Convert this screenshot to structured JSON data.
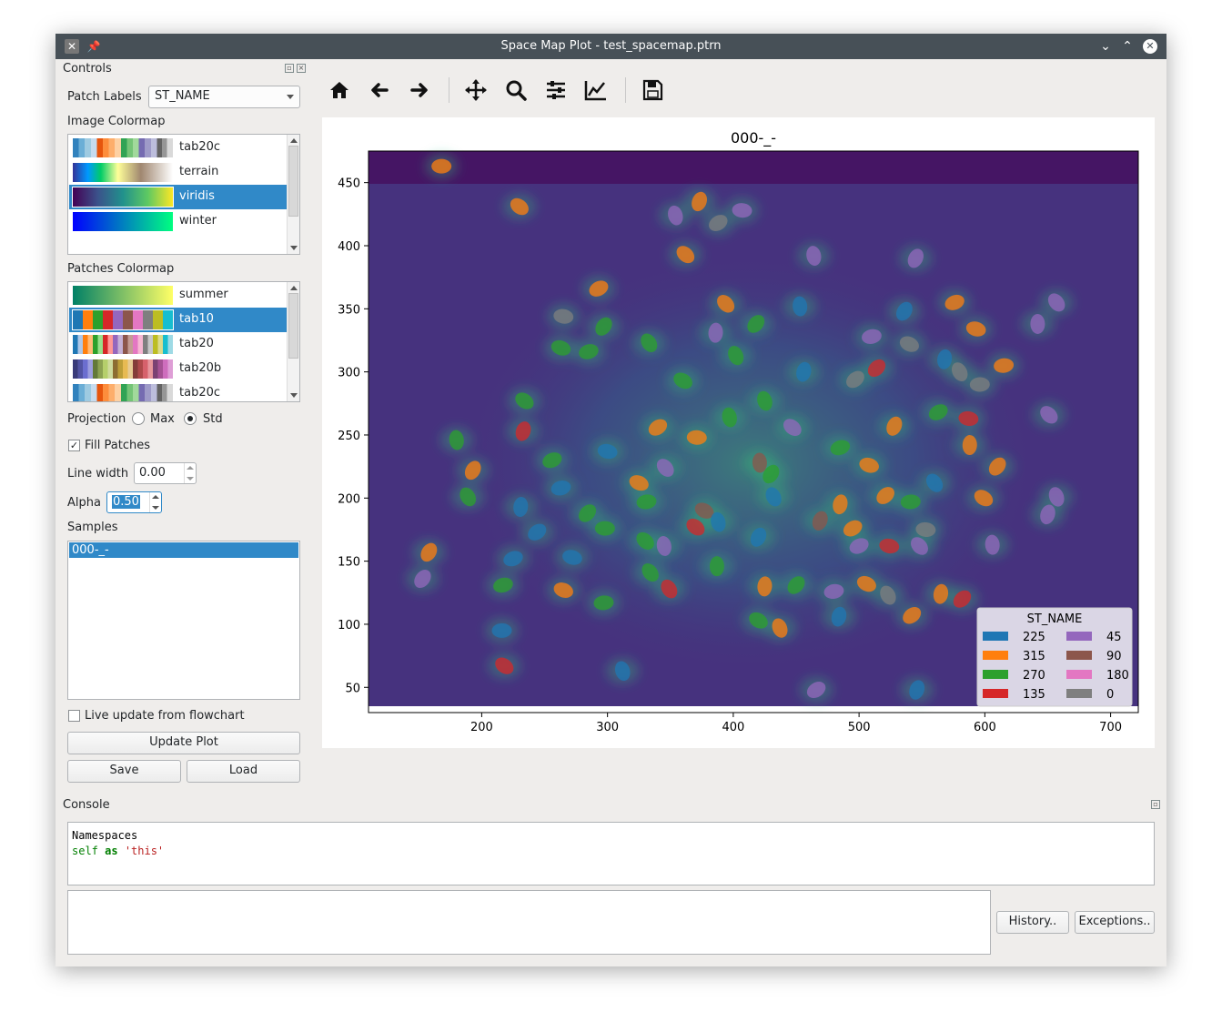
{
  "window": {
    "title": "Space Map Plot - test_spacemap.ptrn"
  },
  "controls": {
    "title": "Controls",
    "patch_labels": {
      "label": "Patch Labels",
      "value": "ST_NAME"
    },
    "image_colormap": {
      "label": "Image Colormap",
      "items": [
        "tab20c",
        "terrain",
        "viridis",
        "winter"
      ],
      "selected": "viridis"
    },
    "patches_colormap": {
      "label": "Patches Colormap",
      "items": [
        "summer",
        "tab10",
        "tab20",
        "tab20b",
        "tab20c"
      ],
      "selected": "tab10"
    },
    "projection": {
      "label": "Projection",
      "options": [
        "Max",
        "Std"
      ],
      "selected": "Std"
    },
    "fill_patches": {
      "label": "Fill Patches",
      "checked": true
    },
    "line_width": {
      "label": "Line width",
      "value": "0.00"
    },
    "alpha": {
      "label": "Alpha",
      "value": "0.50"
    },
    "samples": {
      "label": "Samples",
      "items": [
        "000-_-"
      ]
    },
    "live_update": {
      "label": "Live update from flowchart",
      "checked": false
    },
    "update_plot": "Update Plot",
    "save": "Save",
    "load": "Load"
  },
  "toolbar": {
    "icons": [
      "home-icon",
      "back-arrow-icon",
      "forward-arrow-icon",
      "pan-icon",
      "zoom-icon",
      "configure-subplots-icon",
      "edit-axis-icon",
      "save-icon"
    ]
  },
  "chart_data": {
    "type": "scatter",
    "title": "000-_-",
    "xlabel": "",
    "ylabel": "",
    "xlim": [
      110,
      722
    ],
    "ylim": [
      30,
      475
    ],
    "xticks": [
      200,
      300,
      400,
      500,
      600,
      700
    ],
    "yticks": [
      50,
      100,
      150,
      200,
      250,
      300,
      350,
      400,
      450
    ],
    "grid": false,
    "legend": {
      "title": "ST_NAME",
      "placement": "bottom-right",
      "entries": [
        {
          "label": "225",
          "color": "#1f77b4"
        },
        {
          "label": "315",
          "color": "#ff7f0e"
        },
        {
          "label": "270",
          "color": "#2ca02c"
        },
        {
          "label": "135",
          "color": "#d62728"
        },
        {
          "label": "45",
          "color": "#9467bd"
        },
        {
          "label": "90",
          "color": "#8c564b"
        },
        {
          "label": "180",
          "color": "#e377c2"
        },
        {
          "label": "0",
          "color": "#7f7f7f"
        }
      ]
    },
    "image_colormap": "viridis",
    "patch_alpha": 0.5,
    "patches": [
      {
        "x": 168,
        "y": 463,
        "label": "315"
      },
      {
        "x": 230,
        "y": 431,
        "label": "315"
      },
      {
        "x": 354,
        "y": 424,
        "label": "45"
      },
      {
        "x": 373,
        "y": 435,
        "label": "315"
      },
      {
        "x": 388,
        "y": 418,
        "label": "0"
      },
      {
        "x": 407,
        "y": 428,
        "label": "45"
      },
      {
        "x": 362,
        "y": 393,
        "label": "315"
      },
      {
        "x": 464,
        "y": 392,
        "label": "45"
      },
      {
        "x": 545,
        "y": 390,
        "label": "45"
      },
      {
        "x": 293,
        "y": 366,
        "label": "315"
      },
      {
        "x": 265,
        "y": 344,
        "label": "0"
      },
      {
        "x": 394,
        "y": 354,
        "label": "315"
      },
      {
        "x": 453,
        "y": 352,
        "label": "225"
      },
      {
        "x": 536,
        "y": 348,
        "label": "225"
      },
      {
        "x": 576,
        "y": 355,
        "label": "315"
      },
      {
        "x": 593,
        "y": 334,
        "label": "315"
      },
      {
        "x": 657,
        "y": 355,
        "label": "45"
      },
      {
        "x": 642,
        "y": 338,
        "label": "45"
      },
      {
        "x": 297,
        "y": 336,
        "label": "270"
      },
      {
        "x": 285,
        "y": 316,
        "label": "270"
      },
      {
        "x": 263,
        "y": 319,
        "label": "270"
      },
      {
        "x": 333,
        "y": 323,
        "label": "270"
      },
      {
        "x": 386,
        "y": 331,
        "label": "45"
      },
      {
        "x": 418,
        "y": 338,
        "label": "270"
      },
      {
        "x": 510,
        "y": 328,
        "label": "45"
      },
      {
        "x": 540,
        "y": 322,
        "label": "0"
      },
      {
        "x": 580,
        "y": 300,
        "label": "0"
      },
      {
        "x": 568,
        "y": 310,
        "label": "225"
      },
      {
        "x": 514,
        "y": 303,
        "label": "135"
      },
      {
        "x": 615,
        "y": 305,
        "label": "315"
      },
      {
        "x": 360,
        "y": 293,
        "label": "270"
      },
      {
        "x": 402,
        "y": 313,
        "label": "270"
      },
      {
        "x": 456,
        "y": 300,
        "label": "225"
      },
      {
        "x": 497,
        "y": 294,
        "label": "0"
      },
      {
        "x": 596,
        "y": 290,
        "label": "0"
      },
      {
        "x": 234,
        "y": 277,
        "label": "270"
      },
      {
        "x": 425,
        "y": 277,
        "label": "270"
      },
      {
        "x": 233,
        "y": 253,
        "label": "135"
      },
      {
        "x": 340,
        "y": 256,
        "label": "315"
      },
      {
        "x": 371,
        "y": 248,
        "label": "315"
      },
      {
        "x": 447,
        "y": 256,
        "label": "45"
      },
      {
        "x": 397,
        "y": 264,
        "label": "270"
      },
      {
        "x": 528,
        "y": 257,
        "label": "315"
      },
      {
        "x": 563,
        "y": 268,
        "label": "270"
      },
      {
        "x": 587,
        "y": 263,
        "label": "135"
      },
      {
        "x": 651,
        "y": 266,
        "label": "45"
      },
      {
        "x": 180,
        "y": 246,
        "label": "270"
      },
      {
        "x": 193,
        "y": 222,
        "label": "315"
      },
      {
        "x": 256,
        "y": 230,
        "label": "270"
      },
      {
        "x": 300,
        "y": 237,
        "label": "225"
      },
      {
        "x": 346,
        "y": 224,
        "label": "45"
      },
      {
        "x": 421,
        "y": 228,
        "label": "90"
      },
      {
        "x": 430,
        "y": 219,
        "label": "270"
      },
      {
        "x": 485,
        "y": 240,
        "label": "270"
      },
      {
        "x": 508,
        "y": 226,
        "label": "315"
      },
      {
        "x": 560,
        "y": 212,
        "label": "225"
      },
      {
        "x": 588,
        "y": 242,
        "label": "315"
      },
      {
        "x": 610,
        "y": 225,
        "label": "315"
      },
      {
        "x": 263,
        "y": 208,
        "label": "225"
      },
      {
        "x": 325,
        "y": 212,
        "label": "315"
      },
      {
        "x": 189,
        "y": 201,
        "label": "270"
      },
      {
        "x": 231,
        "y": 193,
        "label": "225"
      },
      {
        "x": 284,
        "y": 188,
        "label": "270"
      },
      {
        "x": 331,
        "y": 197,
        "label": "270"
      },
      {
        "x": 377,
        "y": 190,
        "label": "90"
      },
      {
        "x": 432,
        "y": 201,
        "label": "225"
      },
      {
        "x": 485,
        "y": 195,
        "label": "315"
      },
      {
        "x": 521,
        "y": 202,
        "label": "315"
      },
      {
        "x": 541,
        "y": 197,
        "label": "270"
      },
      {
        "x": 599,
        "y": 200,
        "label": "315"
      },
      {
        "x": 657,
        "y": 201,
        "label": "45"
      },
      {
        "x": 650,
        "y": 187,
        "label": "45"
      },
      {
        "x": 244,
        "y": 173,
        "label": "225"
      },
      {
        "x": 298,
        "y": 176,
        "label": "270"
      },
      {
        "x": 370,
        "y": 177,
        "label": "135"
      },
      {
        "x": 388,
        "y": 181,
        "label": "225"
      },
      {
        "x": 469,
        "y": 182,
        "label": "90"
      },
      {
        "x": 495,
        "y": 176,
        "label": "315"
      },
      {
        "x": 553,
        "y": 175,
        "label": "0"
      },
      {
        "x": 330,
        "y": 166,
        "label": "270"
      },
      {
        "x": 345,
        "y": 162,
        "label": "45"
      },
      {
        "x": 420,
        "y": 169,
        "label": "225"
      },
      {
        "x": 500,
        "y": 162,
        "label": "45"
      },
      {
        "x": 524,
        "y": 162,
        "label": "135"
      },
      {
        "x": 548,
        "y": 162,
        "label": "45"
      },
      {
        "x": 606,
        "y": 163,
        "label": "45"
      },
      {
        "x": 158,
        "y": 157,
        "label": "315"
      },
      {
        "x": 225,
        "y": 152,
        "label": "225"
      },
      {
        "x": 272,
        "y": 153,
        "label": "225"
      },
      {
        "x": 334,
        "y": 141,
        "label": "270"
      },
      {
        "x": 387,
        "y": 146,
        "label": "270"
      },
      {
        "x": 153,
        "y": 136,
        "label": "45"
      },
      {
        "x": 217,
        "y": 131,
        "label": "270"
      },
      {
        "x": 265,
        "y": 127,
        "label": "315"
      },
      {
        "x": 349,
        "y": 128,
        "label": "135"
      },
      {
        "x": 425,
        "y": 130,
        "label": "315"
      },
      {
        "x": 450,
        "y": 131,
        "label": "270"
      },
      {
        "x": 480,
        "y": 126,
        "label": "45"
      },
      {
        "x": 506,
        "y": 132,
        "label": "315"
      },
      {
        "x": 523,
        "y": 123,
        "label": "0"
      },
      {
        "x": 565,
        "y": 124,
        "label": "315"
      },
      {
        "x": 582,
        "y": 120,
        "label": "135"
      },
      {
        "x": 297,
        "y": 117,
        "label": "270"
      },
      {
        "x": 420,
        "y": 103,
        "label": "270"
      },
      {
        "x": 437,
        "y": 97,
        "label": "315"
      },
      {
        "x": 484,
        "y": 106,
        "label": "225"
      },
      {
        "x": 542,
        "y": 107,
        "label": "315"
      },
      {
        "x": 216,
        "y": 95,
        "label": "225"
      },
      {
        "x": 218,
        "y": 67,
        "label": "135"
      },
      {
        "x": 312,
        "y": 63,
        "label": "225"
      },
      {
        "x": 546,
        "y": 48,
        "label": "225"
      },
      {
        "x": 466,
        "y": 48,
        "label": "45"
      }
    ]
  },
  "console": {
    "title": "Console",
    "lines": [
      {
        "text": "Namespaces",
        "color": "#000000"
      },
      {
        "parts": [
          "self",
          " as ",
          "'this'"
        ]
      }
    ],
    "history": "History..",
    "exceptions": "Exceptions.."
  }
}
